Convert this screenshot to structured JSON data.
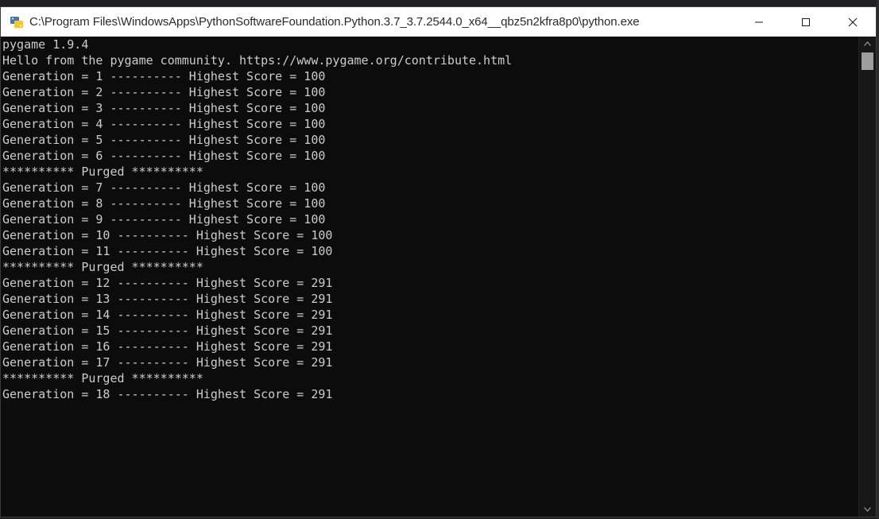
{
  "window": {
    "title": "C:\\Program Files\\WindowsApps\\PythonSoftwareFoundation.Python.3.7_3.7.2544.0_x64__qbz5n2kfra8p0\\python.exe",
    "icon": "python-icon",
    "controls": {
      "minimize": "—",
      "maximize": "☐",
      "close": "✕"
    }
  },
  "console": {
    "background": "#0c0c0c",
    "foreground": "#cccccc",
    "lines": [
      "pygame 1.9.4",
      "Hello from the pygame community. https://www.pygame.org/contribute.html",
      "Generation = 1 ---------- Highest Score = 100",
      "Generation = 2 ---------- Highest Score = 100",
      "Generation = 3 ---------- Highest Score = 100",
      "Generation = 4 ---------- Highest Score = 100",
      "Generation = 5 ---------- Highest Score = 100",
      "Generation = 6 ---------- Highest Score = 100",
      "********** Purged **********",
      "Generation = 7 ---------- Highest Score = 100",
      "Generation = 8 ---------- Highest Score = 100",
      "Generation = 9 ---------- Highest Score = 100",
      "Generation = 10 ---------- Highest Score = 100",
      "Generation = 11 ---------- Highest Score = 100",
      "********** Purged **********",
      "Generation = 12 ---------- Highest Score = 291",
      "Generation = 13 ---------- Highest Score = 291",
      "Generation = 14 ---------- Highest Score = 291",
      "Generation = 15 ---------- Highest Score = 291",
      "Generation = 16 ---------- Highest Score = 291",
      "Generation = 17 ---------- Highest Score = 291",
      "********** Purged **********",
      "Generation = 18 ---------- Highest Score = 291"
    ]
  },
  "scrollbar": {
    "up_icon": "scroll-up-arrow-icon",
    "down_icon": "scroll-down-arrow-icon"
  }
}
